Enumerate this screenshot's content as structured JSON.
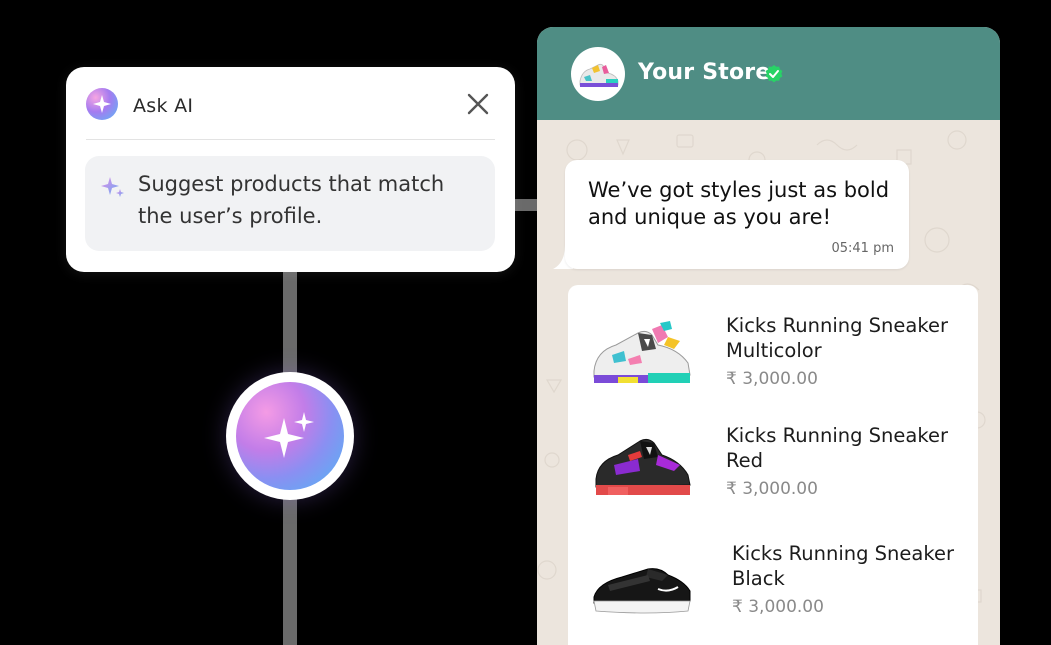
{
  "ask_ai": {
    "title": "Ask AI",
    "prompt": "Suggest products that match the user’s profile.",
    "close_icon": "close-icon",
    "sparkle_icon": "sparkle-icon"
  },
  "store": {
    "name": "Your Store",
    "verified": true,
    "header_color": "#4f8d84"
  },
  "message": {
    "text": "We’ve got styles just as bold and unique as you are!",
    "time": "05:41 pm"
  },
  "products": [
    {
      "name": "Kicks Running Sneaker Multicolor",
      "price": "₹ 3,000.00",
      "icon": "multicolor-sneaker-image"
    },
    {
      "name": "Kicks Running Sneaker Red",
      "price": "₹ 3,000.00",
      "icon": "red-sneaker-image"
    },
    {
      "name": "Kicks Running Sneaker Black",
      "price": "₹ 3,000.00",
      "icon": "black-sneaker-image"
    }
  ]
}
